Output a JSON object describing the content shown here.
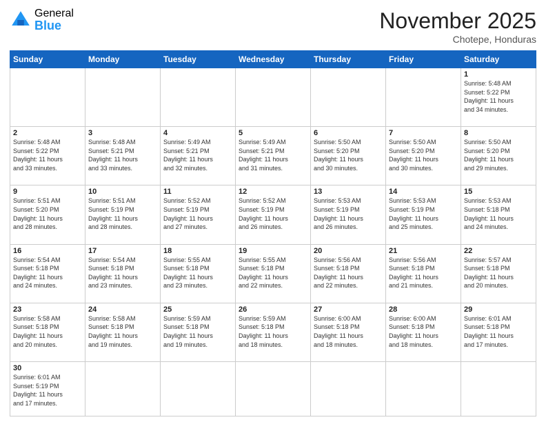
{
  "logo": {
    "general": "General",
    "blue": "Blue"
  },
  "header": {
    "month": "November 2025",
    "location": "Chotepe, Honduras"
  },
  "weekdays": [
    "Sunday",
    "Monday",
    "Tuesday",
    "Wednesday",
    "Thursday",
    "Friday",
    "Saturday"
  ],
  "weeks": [
    [
      null,
      null,
      null,
      null,
      null,
      null,
      {
        "day": "1",
        "sunrise": "5:48 AM",
        "sunset": "5:22 PM",
        "hours": "11 hours",
        "minutes": "and 34 minutes."
      }
    ],
    [
      {
        "day": "2",
        "sunrise": "5:48 AM",
        "sunset": "5:22 PM",
        "hours": "11 hours",
        "minutes": "and 33 minutes."
      },
      {
        "day": "3",
        "sunrise": "5:48 AM",
        "sunset": "5:21 PM",
        "hours": "11 hours",
        "minutes": "and 33 minutes."
      },
      {
        "day": "4",
        "sunrise": "5:49 AM",
        "sunset": "5:21 PM",
        "hours": "11 hours",
        "minutes": "and 32 minutes."
      },
      {
        "day": "5",
        "sunrise": "5:49 AM",
        "sunset": "5:21 PM",
        "hours": "11 hours",
        "minutes": "and 31 minutes."
      },
      {
        "day": "6",
        "sunrise": "5:50 AM",
        "sunset": "5:20 PM",
        "hours": "11 hours",
        "minutes": "and 30 minutes."
      },
      {
        "day": "7",
        "sunrise": "5:50 AM",
        "sunset": "5:20 PM",
        "hours": "11 hours",
        "minutes": "and 30 minutes."
      },
      {
        "day": "8",
        "sunrise": "5:50 AM",
        "sunset": "5:20 PM",
        "hours": "11 hours",
        "minutes": "and 29 minutes."
      }
    ],
    [
      {
        "day": "9",
        "sunrise": "5:51 AM",
        "sunset": "5:20 PM",
        "hours": "11 hours",
        "minutes": "and 28 minutes."
      },
      {
        "day": "10",
        "sunrise": "5:51 AM",
        "sunset": "5:19 PM",
        "hours": "11 hours",
        "minutes": "and 28 minutes."
      },
      {
        "day": "11",
        "sunrise": "5:52 AM",
        "sunset": "5:19 PM",
        "hours": "11 hours",
        "minutes": "and 27 minutes."
      },
      {
        "day": "12",
        "sunrise": "5:52 AM",
        "sunset": "5:19 PM",
        "hours": "11 hours",
        "minutes": "and 26 minutes."
      },
      {
        "day": "13",
        "sunrise": "5:53 AM",
        "sunset": "5:19 PM",
        "hours": "11 hours",
        "minutes": "and 26 minutes."
      },
      {
        "day": "14",
        "sunrise": "5:53 AM",
        "sunset": "5:19 PM",
        "hours": "11 hours",
        "minutes": "and 25 minutes."
      },
      {
        "day": "15",
        "sunrise": "5:53 AM",
        "sunset": "5:18 PM",
        "hours": "11 hours",
        "minutes": "and 24 minutes."
      }
    ],
    [
      {
        "day": "16",
        "sunrise": "5:54 AM",
        "sunset": "5:18 PM",
        "hours": "11 hours",
        "minutes": "and 24 minutes."
      },
      {
        "day": "17",
        "sunrise": "5:54 AM",
        "sunset": "5:18 PM",
        "hours": "11 hours",
        "minutes": "and 23 minutes."
      },
      {
        "day": "18",
        "sunrise": "5:55 AM",
        "sunset": "5:18 PM",
        "hours": "11 hours",
        "minutes": "and 23 minutes."
      },
      {
        "day": "19",
        "sunrise": "5:55 AM",
        "sunset": "5:18 PM",
        "hours": "11 hours",
        "minutes": "and 22 minutes."
      },
      {
        "day": "20",
        "sunrise": "5:56 AM",
        "sunset": "5:18 PM",
        "hours": "11 hours",
        "minutes": "and 22 minutes."
      },
      {
        "day": "21",
        "sunrise": "5:56 AM",
        "sunset": "5:18 PM",
        "hours": "11 hours",
        "minutes": "and 21 minutes."
      },
      {
        "day": "22",
        "sunrise": "5:57 AM",
        "sunset": "5:18 PM",
        "hours": "11 hours",
        "minutes": "and 20 minutes."
      }
    ],
    [
      {
        "day": "23",
        "sunrise": "5:58 AM",
        "sunset": "5:18 PM",
        "hours": "11 hours",
        "minutes": "and 20 minutes."
      },
      {
        "day": "24",
        "sunrise": "5:58 AM",
        "sunset": "5:18 PM",
        "hours": "11 hours",
        "minutes": "and 19 minutes."
      },
      {
        "day": "25",
        "sunrise": "5:59 AM",
        "sunset": "5:18 PM",
        "hours": "11 hours",
        "minutes": "and 19 minutes."
      },
      {
        "day": "26",
        "sunrise": "5:59 AM",
        "sunset": "5:18 PM",
        "hours": "11 hours",
        "minutes": "and 18 minutes."
      },
      {
        "day": "27",
        "sunrise": "6:00 AM",
        "sunset": "5:18 PM",
        "hours": "11 hours",
        "minutes": "and 18 minutes."
      },
      {
        "day": "28",
        "sunrise": "6:00 AM",
        "sunset": "5:18 PM",
        "hours": "11 hours",
        "minutes": "and 18 minutes."
      },
      {
        "day": "29",
        "sunrise": "6:01 AM",
        "sunset": "5:18 PM",
        "hours": "11 hours",
        "minutes": "and 17 minutes."
      }
    ],
    [
      {
        "day": "30",
        "sunrise": "6:01 AM",
        "sunset": "5:19 PM",
        "hours": "11 hours",
        "minutes": "and 17 minutes."
      },
      null,
      null,
      null,
      null,
      null,
      null
    ]
  ],
  "labels": {
    "sunrise": "Sunrise:",
    "sunset": "Sunset:",
    "daylight": "Daylight:"
  }
}
